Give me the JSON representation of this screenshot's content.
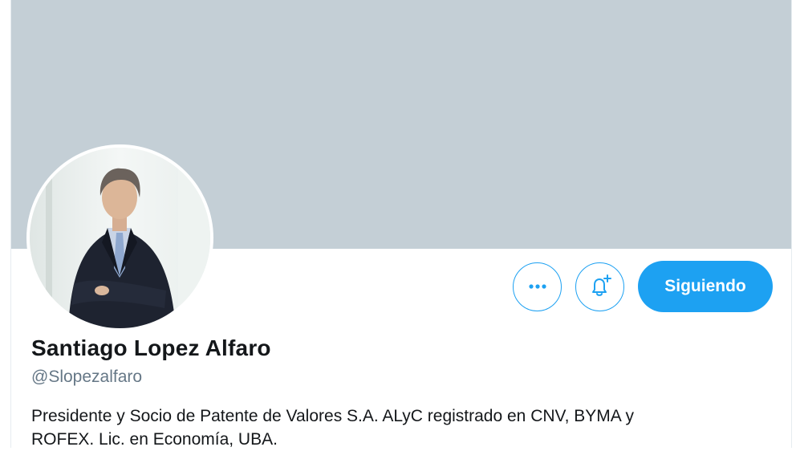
{
  "profile": {
    "name": "Santiago Lopez Alfaro",
    "handle": "@Slopezalfaro",
    "bio_lines": [
      "Presidente y Socio de Patente de Valores S.A. ALyC registrado en CNV, BYMA y",
      "ROFEX. Lic. en Economía, UBA."
    ]
  },
  "actions": {
    "more_icon": "more-dots-icon",
    "notify_icon": "bell-plus-icon",
    "follow_label": "Siguiendo"
  },
  "colors": {
    "banner": "#c4cfd6",
    "accent": "#1da1f2",
    "text": "#14171a",
    "secondary_text": "#657786"
  }
}
